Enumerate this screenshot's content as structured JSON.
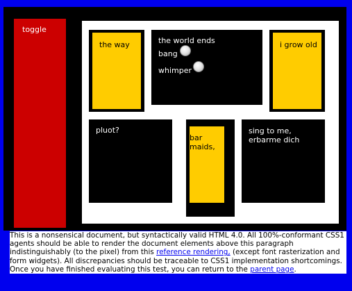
{
  "toggle": {
    "label": "toggle"
  },
  "dd": {
    "text": "the way"
  },
  "list": {
    "title": "the world ends",
    "options": [
      {
        "label": "bang"
      },
      {
        "label": "whimper"
      }
    ]
  },
  "grow": {
    "text": "i grow old"
  },
  "pluot": {
    "text": "pluot?"
  },
  "bar": {
    "text": "bar maids,"
  },
  "sing": {
    "text": "sing to me, erbarme dich"
  },
  "footer": {
    "part1": "This is a nonsensical document, but syntactically valid HTML 4.0. All 100%-conformant CSS1 agents should be able to render the document elements above this paragraph indistinguishably (to the pixel) from this ",
    "link1": "reference rendering,",
    "part2": " (except font rasterization and form widgets). All discrepancies should be traceable to CSS1 implementation shortcomings. Once you have finished evaluating this test, you can return to the ",
    "link2": "parent page",
    "part3": "."
  },
  "colors": {
    "page_background": "#0000ee",
    "toggle_background": "#cc0000",
    "box_yellow": "#ffcc00",
    "box_black": "#000000",
    "body_white": "#ffffff"
  },
  "icons": [
    "radio-button-icon"
  ]
}
